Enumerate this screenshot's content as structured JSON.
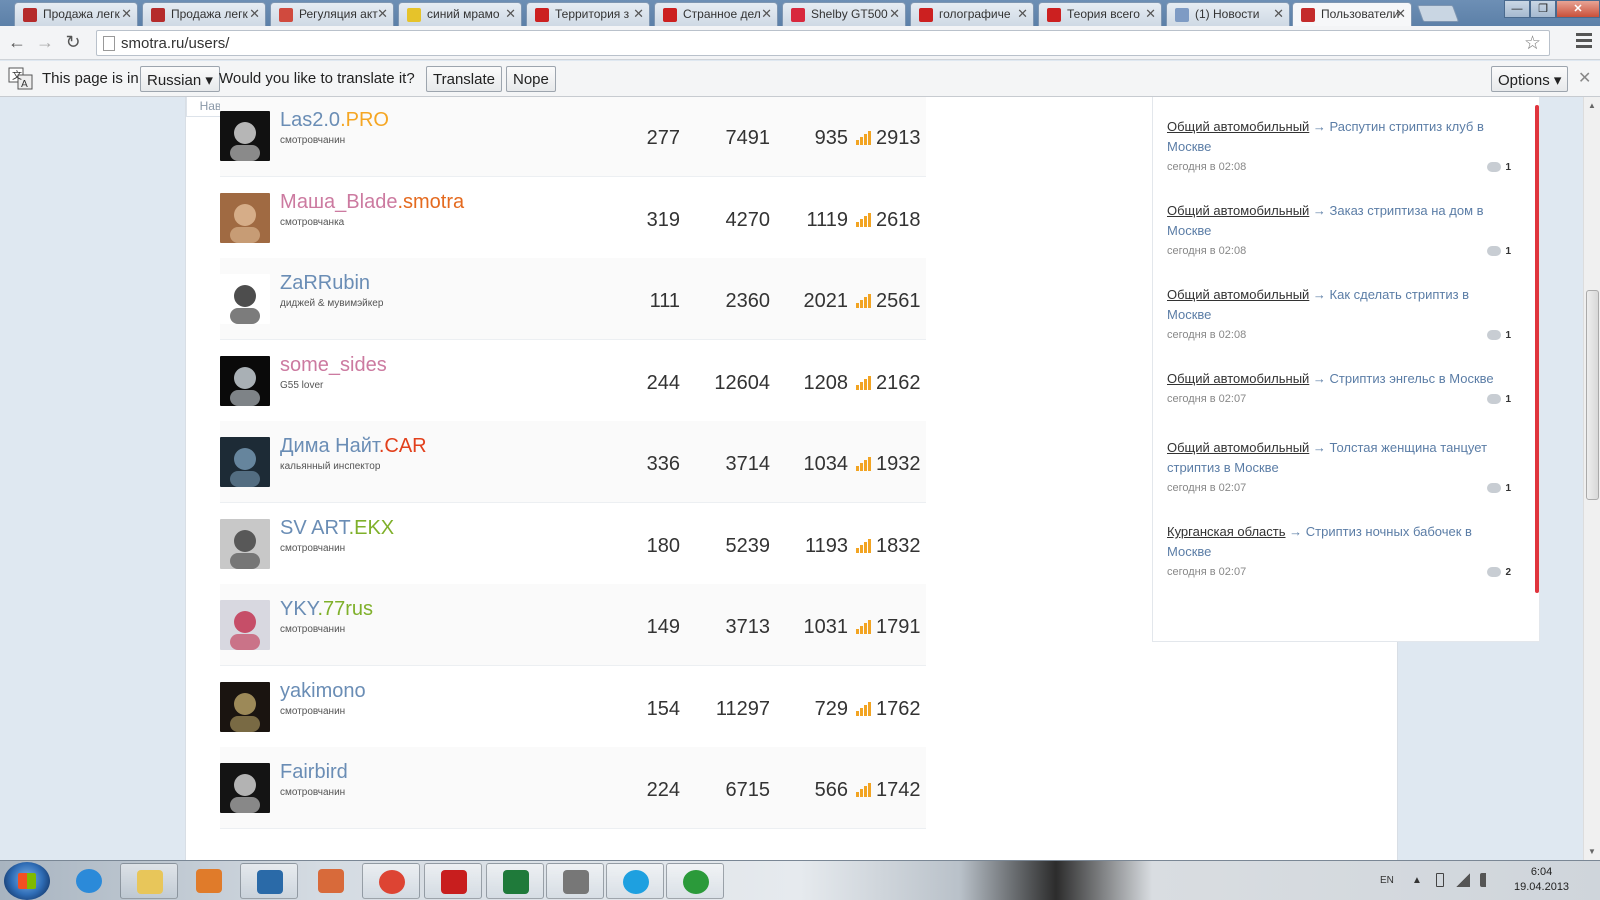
{
  "browser": {
    "tabs": [
      {
        "title": "Продажа легк",
        "color": "#b52b2b"
      },
      {
        "title": "Продажа легк",
        "color": "#b52b2b"
      },
      {
        "title": "Регуляция акт",
        "color": "#d04a3e"
      },
      {
        "title": "синий мрамо",
        "color": "#e6c32a"
      },
      {
        "title": "Территория з",
        "color": "#cc2020"
      },
      {
        "title": "Странное дел",
        "color": "#cc2020"
      },
      {
        "title": "Shelby GT500",
        "color": "#d8283d"
      },
      {
        "title": "голографиче",
        "color": "#cc2020"
      },
      {
        "title": "Теория всего",
        "color": "#cc2020"
      },
      {
        "title": "(1) Новости",
        "color": "#7e9bc4"
      },
      {
        "title": "Пользователи",
        "color": "#c42b2b"
      }
    ],
    "close_glyph": "✕",
    "window_buttons": {
      "minimize": "—",
      "maximize": "❐",
      "close": "✕"
    },
    "url": "smotra.ru/users/",
    "back": "←",
    "forward": "→",
    "reload": "↻",
    "star": "☆"
  },
  "translate_bar": {
    "text1": "This page is in",
    "language": "Russian ▾",
    "text2": "Would you like to translate it?",
    "translate_btn": "Translate",
    "nope_btn": "Nope",
    "options_btn": "Options ▾",
    "close": "✕"
  },
  "page": {
    "naverh": "Наверх",
    "users": [
      {
        "nick": "Las2.0",
        "club": ".PRO",
        "club_color": "#f5a623",
        "girl": false,
        "status": "смотровчанин",
        "s1": "277",
        "s2": "7491",
        "s3": "935",
        "rating": "2913",
        "avatar_bg": "#111111",
        "avatar_fg": "#eeeeee"
      },
      {
        "nick": "Маша_Blade",
        "club": ".smotra",
        "club_color": "#e46a1f",
        "girl": true,
        "status": "смотровчанка",
        "s1": "319",
        "s2": "4270",
        "s3": "1119",
        "rating": "2618",
        "avatar_bg": "#a06a42",
        "avatar_fg": "#e8c4a0"
      },
      {
        "nick": "ZaRRubin",
        "club": "",
        "club_color": "#333333",
        "girl": false,
        "status": "диджей & мувимэйкер",
        "s1": "111",
        "s2": "2360",
        "s3": "2021",
        "rating": "2561",
        "avatar_bg": "#ffffff",
        "avatar_fg": "#111111"
      },
      {
        "nick": "some_sides",
        "club": "",
        "club_color": "#333333",
        "girl": true,
        "status": "G55 lover",
        "s1": "244",
        "s2": "12604",
        "s3": "1208",
        "rating": "2162",
        "avatar_bg": "#0a0a0a",
        "avatar_fg": "#dfe8ef"
      },
      {
        "nick": "Дима Найт",
        "club": ".CAR",
        "club_color": "#e2401c",
        "girl": false,
        "status": "кальянный инспектор",
        "s1": "336",
        "s2": "3714",
        "s3": "1034",
        "rating": "1932",
        "avatar_bg": "#1d2b36",
        "avatar_fg": "#7fa4c0"
      },
      {
        "nick": "SV ART",
        "club": ".EKX",
        "club_color": "#7fb02a",
        "girl": false,
        "status": "смотровчанин",
        "s1": "180",
        "s2": "5239",
        "s3": "1193",
        "rating": "1832",
        "avatar_bg": "#c8c8c8",
        "avatar_fg": "#333333"
      },
      {
        "nick": "YKY",
        "club": ".77rus",
        "club_color": "#7fb02a",
        "girl": false,
        "status": "смотровчанин",
        "s1": "149",
        "s2": "3713",
        "s3": "1031",
        "rating": "1791",
        "avatar_bg": "#d8d8e0",
        "avatar_fg": "#c02040"
      },
      {
        "nick": "yakimono",
        "club": "",
        "club_color": "#333333",
        "girl": false,
        "status": "смотровчанин",
        "s1": "154",
        "s2": "11297",
        "s3": "729",
        "rating": "1762",
        "avatar_bg": "#1a1410",
        "avatar_fg": "#c8b070"
      },
      {
        "nick": "Fairbird",
        "club": "",
        "club_color": "#333333",
        "girl": false,
        "status": "смотровчанин",
        "s1": "224",
        "s2": "6715",
        "s3": "566",
        "rating": "1742",
        "avatar_bg": "#141414",
        "avatar_fg": "#e8e8e8"
      }
    ],
    "posts": [
      {
        "category": "Общий автомобильный",
        "title": "Распутин стриптиз клуб в Москве",
        "time": "сегодня в 02:08",
        "count": "1"
      },
      {
        "category": "Общий автомобильный",
        "title": "Заказ стриптиза на дом в Москве",
        "time": "сегодня в 02:08",
        "count": "1"
      },
      {
        "category": "Общий автомобильный",
        "title": "Как сделать стриптиз в Москве",
        "time": "сегодня в 02:08",
        "count": "1"
      },
      {
        "category": "Общий автомобильный",
        "title": "Стриптиз энгельс в Москве",
        "time": "сегодня в 02:07",
        "count": "1"
      },
      {
        "category": "Общий автомобильный",
        "title": "Толстая женщина танцует стриптиз в Москве",
        "time": "сегодня в 02:07",
        "count": "1"
      },
      {
        "category": "Курганская область",
        "title": "Стриптиз ночных бабочек в Москве",
        "time": "сегодня в 02:07",
        "count": "2"
      }
    ],
    "arrow": " → "
  },
  "taskbar": {
    "items": [
      {
        "name": "internet-explorer",
        "color": "#2b8ad9"
      },
      {
        "name": "file-explorer",
        "color": "#e8c65a"
      },
      {
        "name": "media-player",
        "color": "#e07b2a"
      },
      {
        "name": "hp-app",
        "color": "#2a6aa8"
      },
      {
        "name": "network-app",
        "color": "#d86a3a"
      },
      {
        "name": "chrome",
        "color": "#dd4433"
      },
      {
        "name": "acrobat",
        "color": "#c81e1e"
      },
      {
        "name": "excel",
        "color": "#1f7a3a"
      },
      {
        "name": "settings-app",
        "color": "#777777"
      },
      {
        "name": "skype",
        "color": "#1ea0e0"
      },
      {
        "name": "utorrent",
        "color": "#2b9a3a"
      }
    ],
    "lang": "EN",
    "tray_arrow": "▲",
    "time": "6:04",
    "date": "19.04.2013"
  }
}
